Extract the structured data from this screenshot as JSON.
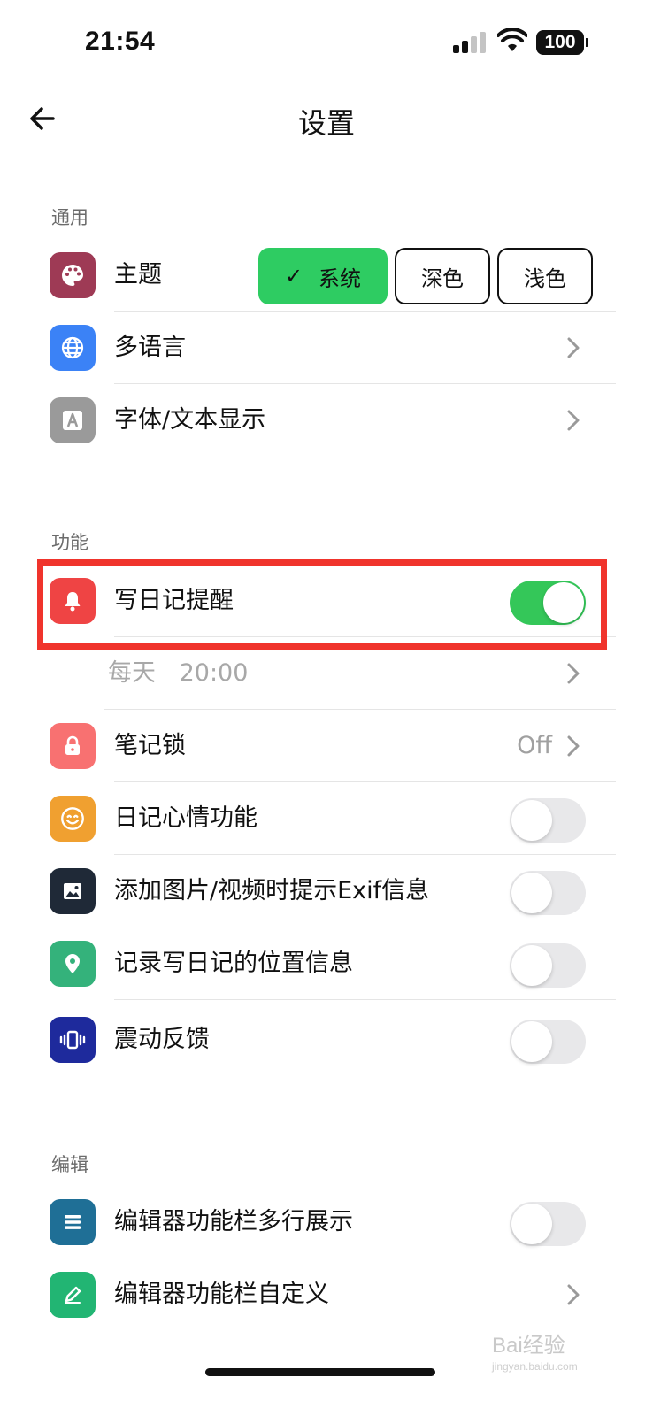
{
  "status": {
    "time": "21:54",
    "battery": "100"
  },
  "nav": {
    "title": "设置"
  },
  "sections": {
    "general": "通用",
    "features": "功能",
    "editing": "编辑"
  },
  "theme": {
    "label": "主题",
    "options": [
      "系统",
      "深色",
      "浅色"
    ],
    "selected": "系统"
  },
  "rows": {
    "language": "多语言",
    "font": "字体/文本显示",
    "reminder": "写日记提醒",
    "reminder_time_day": "每天",
    "reminder_time_value": "20:00",
    "notelock": "笔记锁",
    "notelock_value": "Off",
    "mood": "日记心情功能",
    "exif": "添加图片/视频时提示Exif信息",
    "location": "记录写日记的位置信息",
    "haptic": "震动反馈",
    "toolbar_multiline": "编辑器功能栏多行展示",
    "toolbar_custom": "编辑器功能栏自定义"
  },
  "toggles": {
    "reminder": true,
    "mood": false,
    "exif": false,
    "location": false,
    "haptic": false,
    "toolbar_multiline": false
  },
  "colors": {
    "accent_green": "#34c759",
    "highlight_red": "#f0342c",
    "theme_icon": "#9e3a55",
    "language_icon": "#3b82f6",
    "font_icon": "#9a9a9a",
    "reminder_icon": "#ef4444",
    "lock_icon": "#f87171",
    "mood_icon": "#f0a030",
    "exif_icon": "#1f2937",
    "location_icon": "#34b27b",
    "haptic_icon": "#1e2a9c",
    "multiline_icon": "#1f6f96",
    "custom_icon": "#22b573"
  },
  "watermark": {
    "brand": "Bai经验",
    "url": "jingyan.baidu.com"
  }
}
